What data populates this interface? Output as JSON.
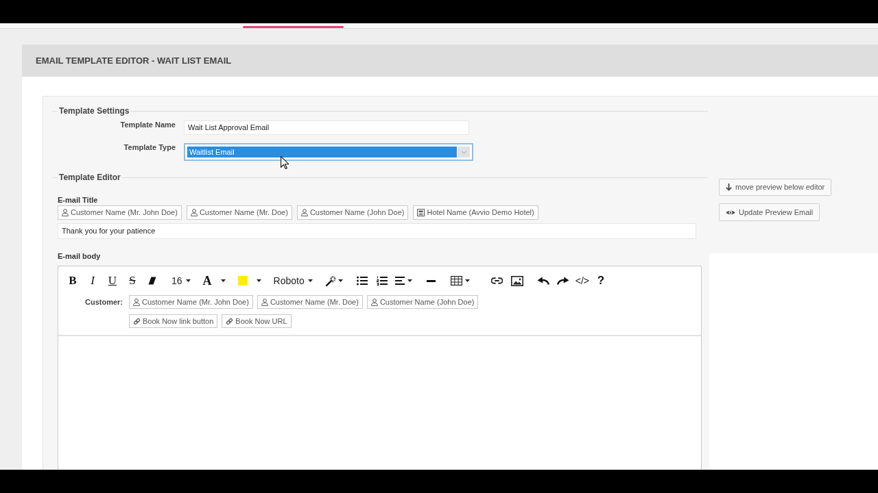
{
  "page_title": "EMAIL TEMPLATE EDITOR - WAIT LIST EMAIL",
  "template_settings": {
    "legend": "Template Settings",
    "fields": [
      {
        "kind": "text",
        "label": "Template Name",
        "value": "Wait List Approval Email",
        "focused": false
      },
      {
        "kind": "select",
        "label": "Template Type",
        "value": "Waitlist Email",
        "focused": true
      }
    ]
  },
  "template_editor": {
    "legend": "Template Editor",
    "title_field": {
      "label": "E-mail Title",
      "merge_fields": [
        {
          "kind": "person",
          "label": "Customer Name (Mr. John Doe)"
        },
        {
          "kind": "person",
          "label": "Customer Name (Mr. Doe)"
        },
        {
          "kind": "person",
          "label": "Customer Name (John Doe)"
        },
        {
          "kind": "hotel",
          "label": "Hotel Name (Avvio Demo Hotel)"
        }
      ],
      "value": "Thank you for your patience"
    },
    "body": {
      "label": "E-mail body",
      "toolbar": {
        "groups": [
          {
            "buttons": [
              {
                "kind": "bold",
                "text": "B",
                "caret": false
              },
              {
                "kind": "italic",
                "text": "I",
                "caret": false
              },
              {
                "kind": "underline",
                "text": "U",
                "caret": false
              },
              {
                "kind": "strikethrough",
                "text": "S",
                "caret": false
              },
              {
                "kind": "eraser",
                "caret": false
              }
            ]
          },
          {
            "buttons": [
              {
                "kind": "font_size",
                "text": "16",
                "caret": true
              }
            ]
          },
          {
            "buttons": [
              {
                "kind": "font_color",
                "text": "A",
                "caret": true
              }
            ]
          },
          {
            "buttons": [
              {
                "kind": "highlight",
                "color": "#ffee00",
                "caret": true
              }
            ]
          },
          {
            "buttons": [
              {
                "kind": "font_family",
                "text": "Roboto",
                "caret": true
              }
            ]
          },
          {
            "buttons": [
              {
                "kind": "magic",
                "caret": true
              }
            ]
          },
          {
            "buttons": [
              {
                "kind": "bullet_list",
                "caret": false
              },
              {
                "kind": "numbered_list",
                "caret": false
              },
              {
                "kind": "align",
                "caret": true
              }
            ]
          },
          {
            "buttons": [
              {
                "kind": "horizontal_rule",
                "caret": false
              }
            ]
          },
          {
            "buttons": [
              {
                "kind": "table",
                "caret": true
              }
            ]
          },
          {
            "buttons": [
              {
                "kind": "link",
                "caret": false
              },
              {
                "kind": "image",
                "caret": false
              }
            ]
          },
          {
            "buttons": [
              {
                "kind": "undo",
                "caret": false
              },
              {
                "kind": "redo",
                "caret": false
              },
              {
                "kind": "code",
                "text": "</>",
                "caret": false
              },
              {
                "kind": "help",
                "text": "?",
                "caret": false
              }
            ]
          }
        ]
      },
      "insert_rows": [
        {
          "label": "Customer:",
          "buttons": [
            {
              "kind": "person",
              "label": "Customer Name (Mr. John Doe)"
            },
            {
              "kind": "person",
              "label": "Customer Name (Mr. Doe)"
            },
            {
              "kind": "person",
              "label": "Customer Name (John Doe)"
            }
          ]
        },
        {
          "buttons": [
            {
              "kind": "link",
              "label": "Book Now link button"
            },
            {
              "kind": "link",
              "label": "Book Now URL"
            }
          ]
        }
      ]
    }
  },
  "preview_actions": [
    {
      "kind": "move_down",
      "label": "move preview below editor"
    },
    {
      "kind": "update",
      "label": "Update Preview Email"
    }
  ]
}
